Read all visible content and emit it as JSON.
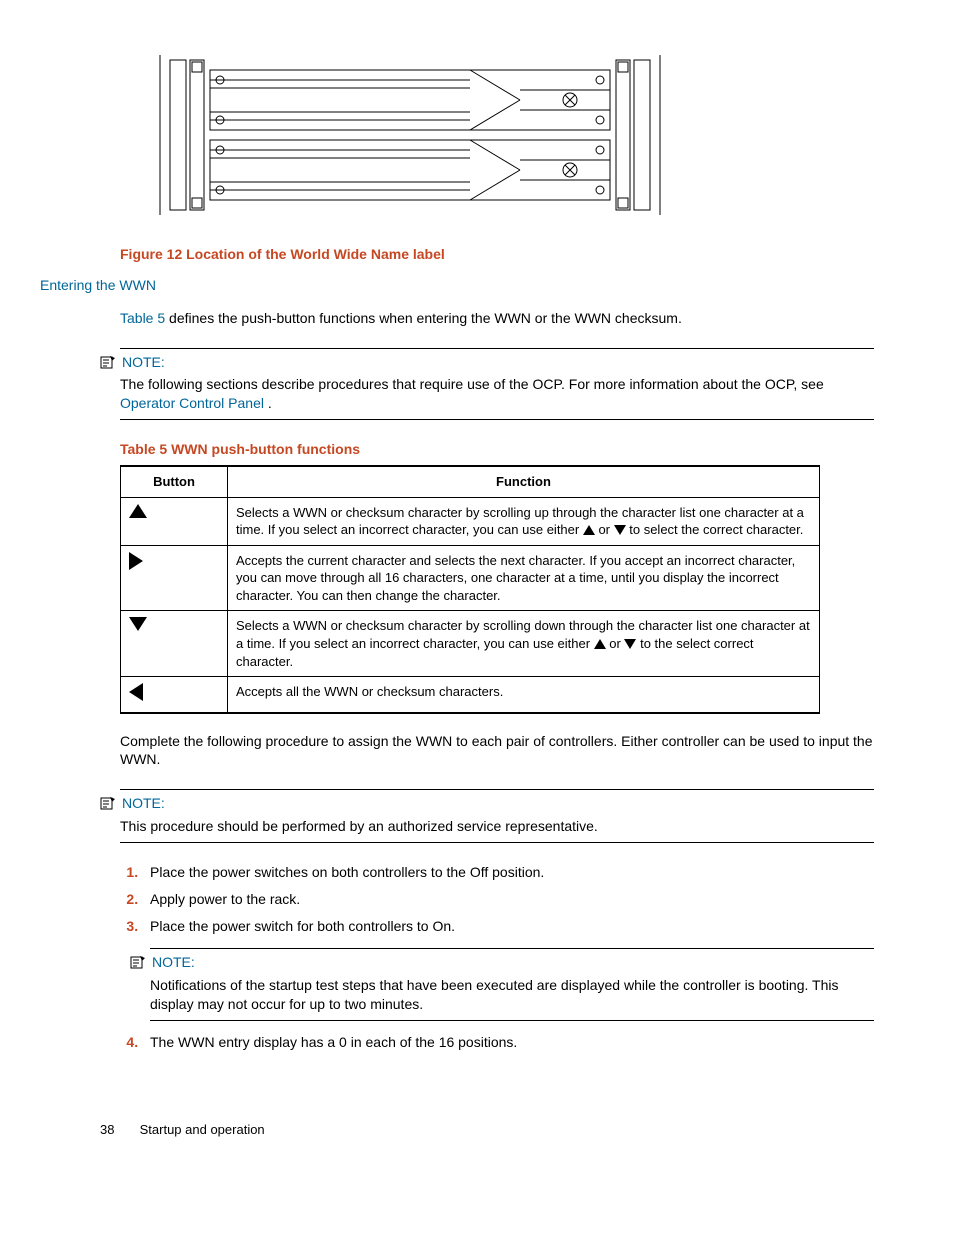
{
  "figure_caption": "Figure 12 Location of the World Wide Name label",
  "section_heading": "Entering the WWN",
  "intro_pre": "Table 5",
  "intro_post": " defines the push-button functions when entering the WWN or the WWN checksum.",
  "note1": {
    "title": "NOTE:",
    "body_pre": "The following sections describe procedures that require use of the OCP. For more information about the OCP, see ",
    "body_link": "Operator Control Panel",
    "body_post": " ."
  },
  "table_caption": "Table 5 WWN push-button functions",
  "table": {
    "head_button": "Button",
    "head_function": "Function",
    "rows": [
      {
        "icon": "up",
        "pre": "Selects a WWN or checksum character by scrolling up through the character list one character at a time. If you select an incorrect character, you can use either ",
        "post": " to select the correct character."
      },
      {
        "icon": "right",
        "text": "Accepts the current character and selects the next character. If you accept an incorrect character, you can move through all 16 characters, one character at a time, until you display the incorrect character. You can then change the character."
      },
      {
        "icon": "down",
        "pre": "Selects a WWN or checksum character by scrolling down through the character list one character at a time. If you select an incorrect character, you can use either ",
        "post": " to the select correct character."
      },
      {
        "icon": "left",
        "text": "Accepts all the WWN or checksum characters."
      }
    ],
    "inline_or": " or "
  },
  "after_table": "Complete the following procedure to assign the WWN to each pair of controllers. Either controller can be used to input the WWN.",
  "note2": {
    "title": "NOTE:",
    "body": "This procedure should be performed by an authorized service representative."
  },
  "steps": {
    "s1": "Place the power switches on both controllers to the Off position.",
    "s2": "Apply power to the rack.",
    "s3": "Place the power switch for both controllers to On.",
    "s3_note_title": "NOTE:",
    "s3_note_body": "Notifications of the startup test steps that have been executed are displayed while the controller is booting. This display may not occur for up to two minutes.",
    "s4": "The WWN entry display has a 0 in each of the 16 positions."
  },
  "footer": {
    "page": "38",
    "section": "Startup and operation"
  }
}
